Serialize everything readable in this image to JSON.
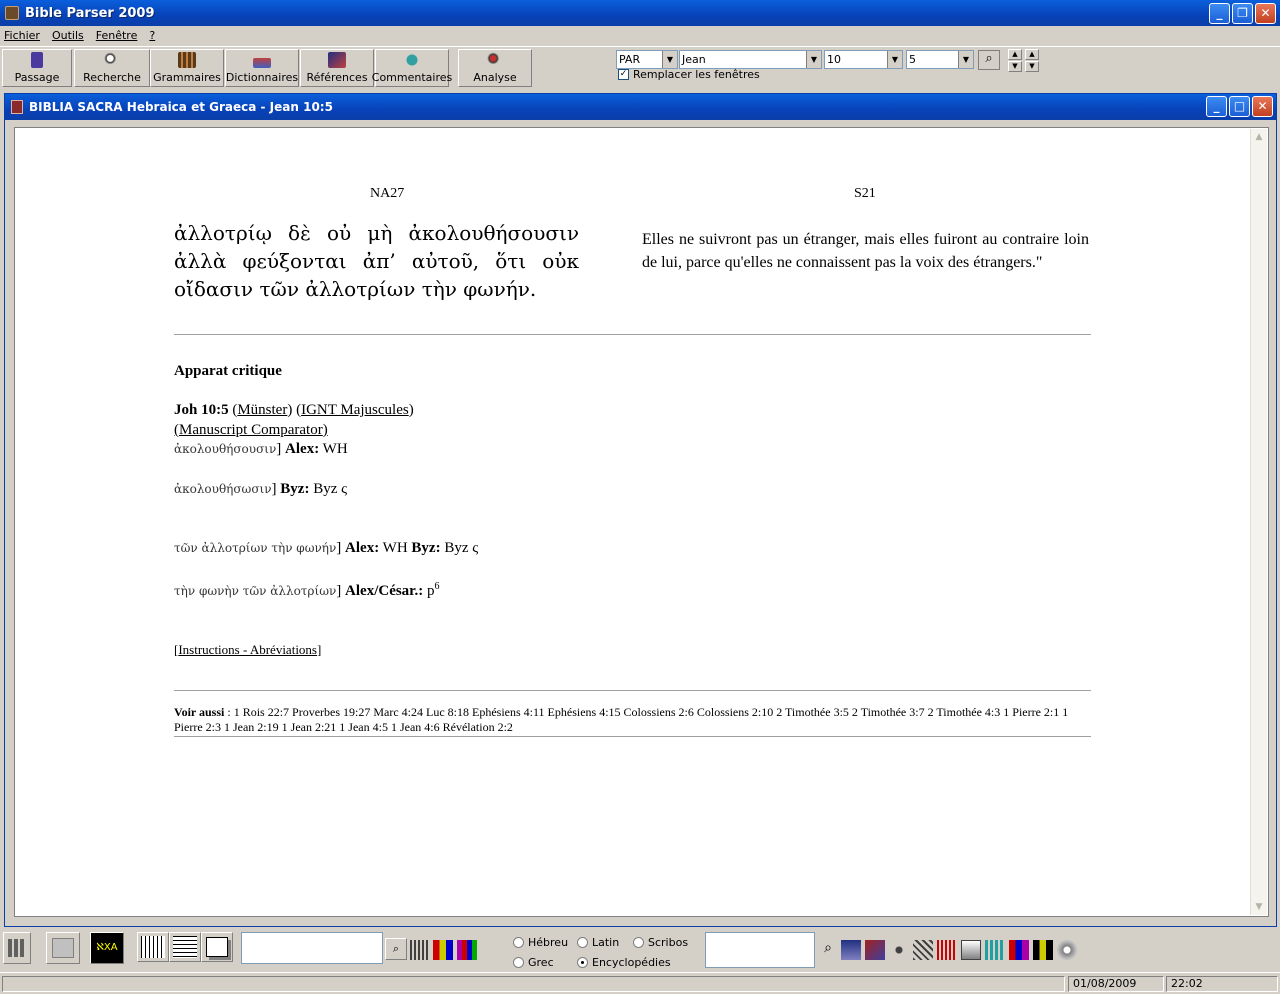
{
  "app": {
    "title": "Bible Parser 2009"
  },
  "menu": [
    "Fichier",
    "Outils",
    "Fenêtre",
    "?"
  ],
  "toolbar": {
    "buttons": [
      "Passage",
      "Recherche",
      "Grammaires",
      "Dictionnaires",
      "Références",
      "Commentaires",
      "Analyse"
    ],
    "version_select": "PAR",
    "book_select": "Jean",
    "chapter_select": "10",
    "verse_select": "5",
    "replace_windows_label": "Remplacer les fenêtres",
    "replace_windows_checked": true
  },
  "child_window": {
    "title": "BIBLIA SACRA Hebraica et Graeca - Jean 10:5"
  },
  "passage": {
    "left_header": "NA27",
    "right_header": "S21",
    "greek_text": " ἀλλοτρίῳ δὲ οὐ μὴ ἀκολουθήσουσιν ἀλλὰ φεύξονται ἀπ’ αὐτοῦ, ὅτι οὐκ οἴδασιν τῶν ἀλλοτρίων τὴν φωνήν.",
    "french_text": "Elles ne suivront pas un étranger, mais elles fuiront au contraire loin de lui, parce qu'elles ne connaissent pas la voix des étrangers.\""
  },
  "apparatus": {
    "heading": "Apparat critique",
    "ref": "Joh 10:5",
    "link_munster": "Münster",
    "link_ignt": "IGNT Majuscules",
    "link_manuscript": "Manuscript Comparator",
    "v1_greek": "ἀκολουθήσουσιν",
    "v1_label": "Alex:",
    "v1_witness": "WH",
    "v2_greek": "ἀκολουθήσωσιν",
    "v2_label": "Byz:",
    "v2_witness": "Byz ς",
    "v3_greek": "τῶν ἀλλοτρίων τὴν φωνήν",
    "v3_label1": "Alex:",
    "v3_witness1": "WH",
    "v3_label2": "Byz:",
    "v3_witness2": "Byz ς",
    "v4_greek": "τὴν φωνὴν τῶν ἀλλοτρίων",
    "v4_label": "Alex/César.:",
    "v4_witness": "p",
    "v4_sup": "6",
    "instructions_link": "Instructions - Abréviations"
  },
  "see_also": {
    "label": "Voir aussi",
    "refs": "1 Rois 22:7 Proverbes 19:27 Marc 4:24 Luc 8:18 Ephésiens 4:11 Ephésiens 4:15 Colossiens 2:6 Colossiens 2:10 2 Timothée 3:5 2 Timothée 3:7 2 Timothée 4:3 1 Pierre 2:1 1 Pierre 2:3 1 Jean 2:19 1 Jean 2:21 1 Jean 4:5 1 Jean 4:6 Révélation 2:2"
  },
  "bottom": {
    "radios": [
      {
        "label": "Hébreu",
        "checked": false
      },
      {
        "label": "Latin",
        "checked": false
      },
      {
        "label": "Scribos",
        "checked": false
      },
      {
        "label": "Grec",
        "checked": false
      },
      {
        "label": "Encyclopédies",
        "checked": true
      }
    ]
  },
  "status": {
    "date": "01/08/2009",
    "time": "22:02"
  },
  "colors": {
    "titlebar": "#0a5fdc",
    "face": "#d4d0c8"
  }
}
